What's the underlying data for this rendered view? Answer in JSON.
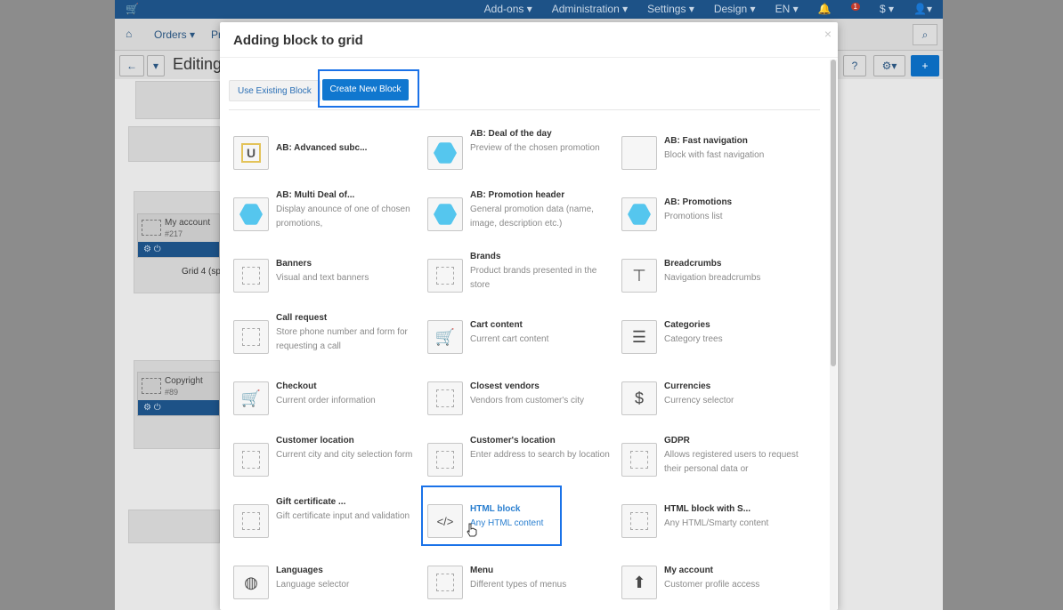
{
  "background": {
    "topbar_items": [
      "Add-ons ▾",
      "Administration ▾",
      "Settings ▾",
      "Design ▾",
      "EN ▾"
    ],
    "notif_count": "1",
    "currency": "$ ▾",
    "nav_orders": "Orders ▾",
    "nav_pr": "Pr",
    "editing": "Editing",
    "widget_my_account": {
      "title": "My account",
      "id": "#217"
    },
    "widget_copyright": {
      "title": "Copyright",
      "id": "#89"
    },
    "grid_label": "Grid 4 (sp"
  },
  "modal": {
    "title": "Adding block to grid",
    "close": "×",
    "tab_existing": "Use Existing Block",
    "tab_new": "Create New Block"
  },
  "blocks": [
    {
      "title": "AB: Advanced subc...",
      "desc": "",
      "icon": "u-icon"
    },
    {
      "title": "AB: Deal of the day",
      "desc": "Preview of the chosen promotion",
      "icon": "hex-icon"
    },
    {
      "title": "AB: Fast navigation",
      "desc": "Block with fast navigation",
      "icon": "blank-icon"
    },
    {
      "title": "AB: Multi Deal of...",
      "desc": "Display anounce of one of chosen promotions,",
      "icon": "hex-icon"
    },
    {
      "title": "AB: Promotion header",
      "desc": "General promotion data (name, image, description etc.)",
      "icon": "hex-icon"
    },
    {
      "title": "AB: Promotions",
      "desc": "Promotions list",
      "icon": "hex-icon"
    },
    {
      "title": "Banners",
      "desc": "Visual and text banners",
      "icon": "dashed-square-icon"
    },
    {
      "title": "Brands",
      "desc": "Product brands presented in the store",
      "icon": "dashed-square-icon"
    },
    {
      "title": "Breadcrumbs",
      "desc": "Navigation breadcrumbs",
      "icon": "signpost-icon"
    },
    {
      "title": "Call request",
      "desc": "Store phone number and form for requesting a call",
      "icon": "dashed-square-icon"
    },
    {
      "title": "Cart content",
      "desc": "Current cart content",
      "icon": "cart-icon"
    },
    {
      "title": "Categories",
      "desc": "Category trees",
      "icon": "list-icon"
    },
    {
      "title": "Checkout",
      "desc": "Current order information",
      "icon": "cart-icon"
    },
    {
      "title": "Closest vendors",
      "desc": "Vendors from customer's city",
      "icon": "dashed-square-icon"
    },
    {
      "title": "Currencies",
      "desc": "Currency selector",
      "icon": "dollar-icon"
    },
    {
      "title": "Customer location",
      "desc": "Current city and city selection form",
      "icon": "dashed-square-icon"
    },
    {
      "title": "Customer's location",
      "desc": "Enter address to search by location",
      "icon": "dashed-square-icon"
    },
    {
      "title": "GDPR",
      "desc": "Allows registered users to request their personal data or",
      "icon": "dashed-square-icon"
    },
    {
      "title": "Gift certificate ...",
      "desc": "Gift certificate input and validation",
      "icon": "dashed-square-icon"
    },
    {
      "title": "HTML block",
      "desc": "Any HTML content",
      "icon": "code-icon"
    },
    {
      "title": "HTML block with S...",
      "desc": "Any HTML/Smarty content",
      "icon": "dashed-square-icon"
    },
    {
      "title": "Languages",
      "desc": "Language selector",
      "icon": "globe-icon"
    },
    {
      "title": "Menu",
      "desc": "Different types of menus",
      "icon": "dashed-square-icon"
    },
    {
      "title": "My account",
      "desc": "Customer profile access",
      "icon": "user-icon"
    }
  ]
}
